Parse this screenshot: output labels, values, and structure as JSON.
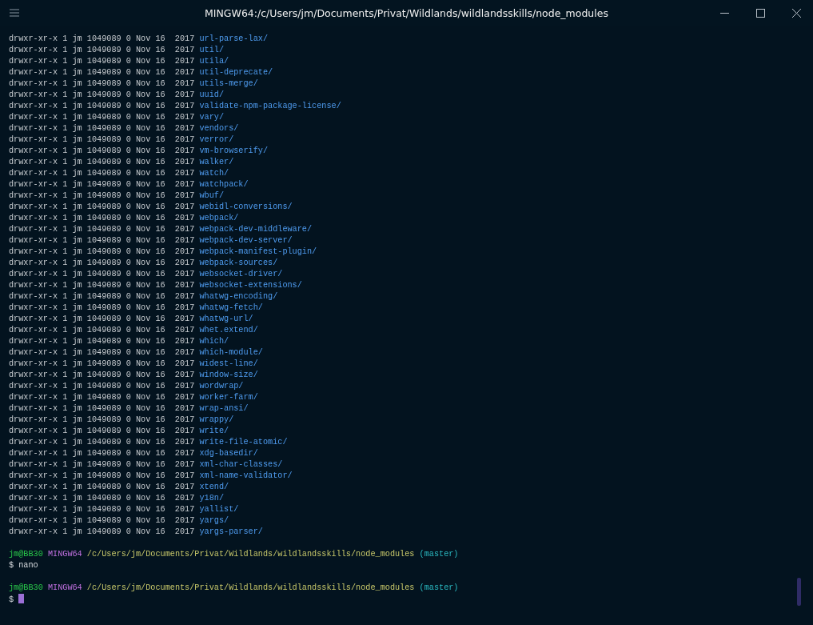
{
  "window": {
    "title": "MINGW64:/c/Users/jm/Documents/Privat/Wildlands/wildlandsskills/node_modules"
  },
  "listing": [
    {
      "info": "drwxr-xr-x 1 jm 1049089 0 Nov 16  2017",
      "name": "url-parse-lax/"
    },
    {
      "info": "drwxr-xr-x 1 jm 1049089 0 Nov 16  2017",
      "name": "util/"
    },
    {
      "info": "drwxr-xr-x 1 jm 1049089 0 Nov 16  2017",
      "name": "utila/"
    },
    {
      "info": "drwxr-xr-x 1 jm 1049089 0 Nov 16  2017",
      "name": "util-deprecate/"
    },
    {
      "info": "drwxr-xr-x 1 jm 1049089 0 Nov 16  2017",
      "name": "utils-merge/"
    },
    {
      "info": "drwxr-xr-x 1 jm 1049089 0 Nov 16  2017",
      "name": "uuid/"
    },
    {
      "info": "drwxr-xr-x 1 jm 1049089 0 Nov 16  2017",
      "name": "validate-npm-package-license/"
    },
    {
      "info": "drwxr-xr-x 1 jm 1049089 0 Nov 16  2017",
      "name": "vary/"
    },
    {
      "info": "drwxr-xr-x 1 jm 1049089 0 Nov 16  2017",
      "name": "vendors/"
    },
    {
      "info": "drwxr-xr-x 1 jm 1049089 0 Nov 16  2017",
      "name": "verror/"
    },
    {
      "info": "drwxr-xr-x 1 jm 1049089 0 Nov 16  2017",
      "name": "vm-browserify/"
    },
    {
      "info": "drwxr-xr-x 1 jm 1049089 0 Nov 16  2017",
      "name": "walker/"
    },
    {
      "info": "drwxr-xr-x 1 jm 1049089 0 Nov 16  2017",
      "name": "watch/"
    },
    {
      "info": "drwxr-xr-x 1 jm 1049089 0 Nov 16  2017",
      "name": "watchpack/"
    },
    {
      "info": "drwxr-xr-x 1 jm 1049089 0 Nov 16  2017",
      "name": "wbuf/"
    },
    {
      "info": "drwxr-xr-x 1 jm 1049089 0 Nov 16  2017",
      "name": "webidl-conversions/"
    },
    {
      "info": "drwxr-xr-x 1 jm 1049089 0 Nov 16  2017",
      "name": "webpack/"
    },
    {
      "info": "drwxr-xr-x 1 jm 1049089 0 Nov 16  2017",
      "name": "webpack-dev-middleware/"
    },
    {
      "info": "drwxr-xr-x 1 jm 1049089 0 Nov 16  2017",
      "name": "webpack-dev-server/"
    },
    {
      "info": "drwxr-xr-x 1 jm 1049089 0 Nov 16  2017",
      "name": "webpack-manifest-plugin/"
    },
    {
      "info": "drwxr-xr-x 1 jm 1049089 0 Nov 16  2017",
      "name": "webpack-sources/"
    },
    {
      "info": "drwxr-xr-x 1 jm 1049089 0 Nov 16  2017",
      "name": "websocket-driver/"
    },
    {
      "info": "drwxr-xr-x 1 jm 1049089 0 Nov 16  2017",
      "name": "websocket-extensions/"
    },
    {
      "info": "drwxr-xr-x 1 jm 1049089 0 Nov 16  2017",
      "name": "whatwg-encoding/"
    },
    {
      "info": "drwxr-xr-x 1 jm 1049089 0 Nov 16  2017",
      "name": "whatwg-fetch/"
    },
    {
      "info": "drwxr-xr-x 1 jm 1049089 0 Nov 16  2017",
      "name": "whatwg-url/"
    },
    {
      "info": "drwxr-xr-x 1 jm 1049089 0 Nov 16  2017",
      "name": "whet.extend/"
    },
    {
      "info": "drwxr-xr-x 1 jm 1049089 0 Nov 16  2017",
      "name": "which/"
    },
    {
      "info": "drwxr-xr-x 1 jm 1049089 0 Nov 16  2017",
      "name": "which-module/"
    },
    {
      "info": "drwxr-xr-x 1 jm 1049089 0 Nov 16  2017",
      "name": "widest-line/"
    },
    {
      "info": "drwxr-xr-x 1 jm 1049089 0 Nov 16  2017",
      "name": "window-size/"
    },
    {
      "info": "drwxr-xr-x 1 jm 1049089 0 Nov 16  2017",
      "name": "wordwrap/"
    },
    {
      "info": "drwxr-xr-x 1 jm 1049089 0 Nov 16  2017",
      "name": "worker-farm/"
    },
    {
      "info": "drwxr-xr-x 1 jm 1049089 0 Nov 16  2017",
      "name": "wrap-ansi/"
    },
    {
      "info": "drwxr-xr-x 1 jm 1049089 0 Nov 16  2017",
      "name": "wrappy/"
    },
    {
      "info": "drwxr-xr-x 1 jm 1049089 0 Nov 16  2017",
      "name": "write/"
    },
    {
      "info": "drwxr-xr-x 1 jm 1049089 0 Nov 16  2017",
      "name": "write-file-atomic/"
    },
    {
      "info": "drwxr-xr-x 1 jm 1049089 0 Nov 16  2017",
      "name": "xdg-basedir/"
    },
    {
      "info": "drwxr-xr-x 1 jm 1049089 0 Nov 16  2017",
      "name": "xml-char-classes/"
    },
    {
      "info": "drwxr-xr-x 1 jm 1049089 0 Nov 16  2017",
      "name": "xml-name-validator/"
    },
    {
      "info": "drwxr-xr-x 1 jm 1049089 0 Nov 16  2017",
      "name": "xtend/"
    },
    {
      "info": "drwxr-xr-x 1 jm 1049089 0 Nov 16  2017",
      "name": "y18n/"
    },
    {
      "info": "drwxr-xr-x 1 jm 1049089 0 Nov 16  2017",
      "name": "yallist/"
    },
    {
      "info": "drwxr-xr-x 1 jm 1049089 0 Nov 16  2017",
      "name": "yargs/"
    },
    {
      "info": "drwxr-xr-x 1 jm 1049089 0 Nov 16  2017",
      "name": "yargs-parser/"
    }
  ],
  "prompts": [
    {
      "user": "jm@BB30",
      "system": "MINGW64",
      "path": "/c/Users/jm/Documents/Privat/Wildlands/wildlandsskills/node_modules",
      "branch": "(master)",
      "symbol": "$",
      "command": "nano",
      "cursor": false
    },
    {
      "user": "jm@BB30",
      "system": "MINGW64",
      "path": "/c/Users/jm/Documents/Privat/Wildlands/wildlandsskills/node_modules",
      "branch": "(master)",
      "symbol": "$",
      "cursor": true
    }
  ]
}
